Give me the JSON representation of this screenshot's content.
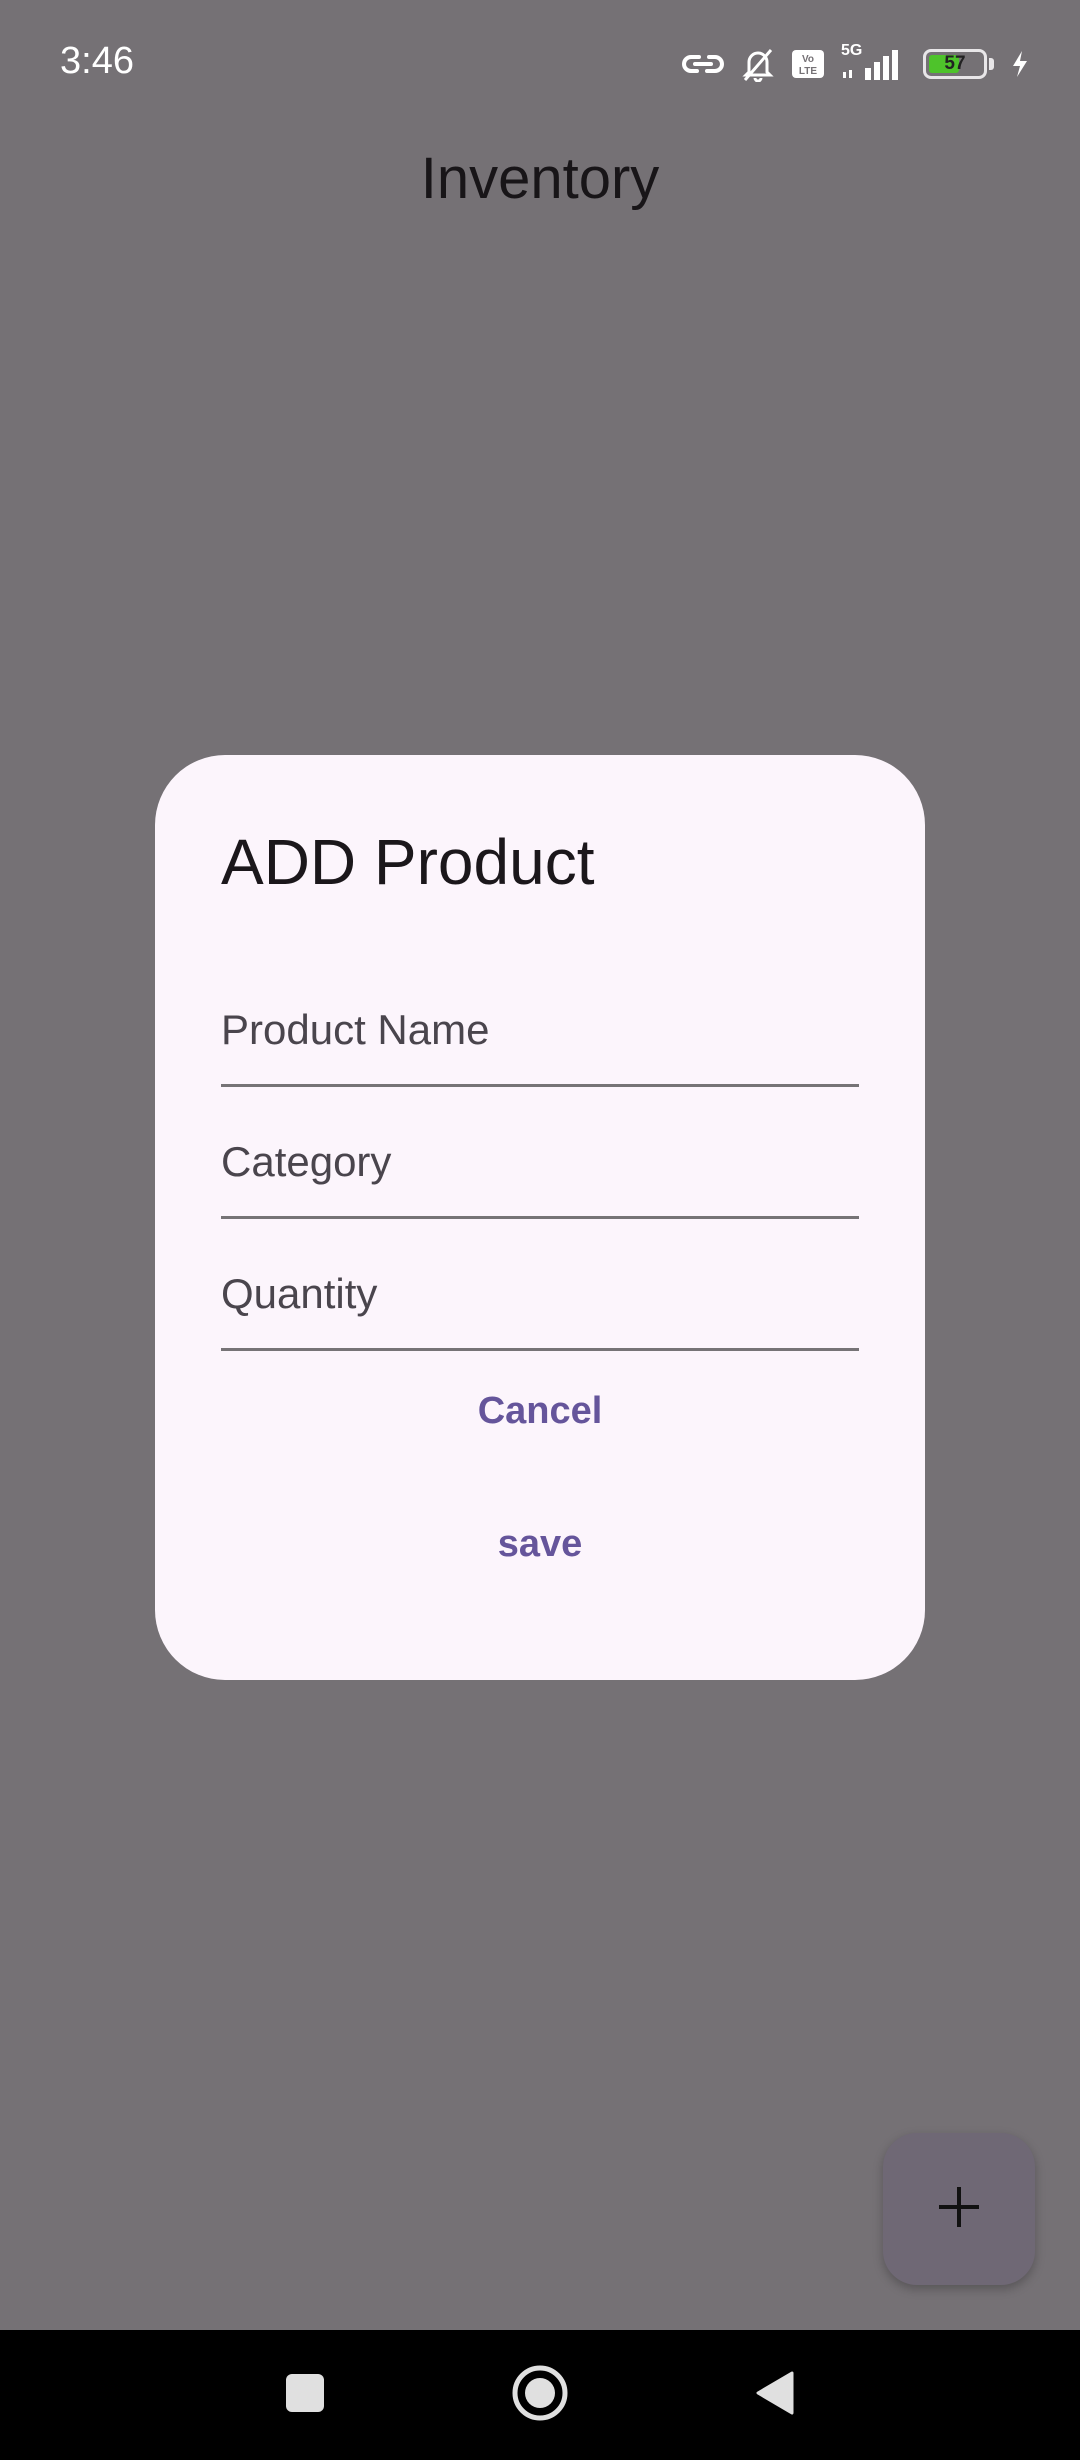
{
  "status_bar": {
    "time": "3:46",
    "network": "5G",
    "volte": "Vo LTE",
    "battery_level": 57,
    "battery_label": "57",
    "icons": [
      "link-icon",
      "bell-off-icon",
      "volte-icon",
      "signal-icon",
      "battery-icon",
      "charging-icon"
    ]
  },
  "app": {
    "title": "Inventory"
  },
  "dialog": {
    "title": "ADD Product",
    "fields": [
      {
        "placeholder": "Product Name",
        "value": ""
      },
      {
        "placeholder": "Category",
        "value": ""
      },
      {
        "placeholder": "Quantity",
        "value": ""
      }
    ],
    "cancel_label": "Cancel",
    "save_label": "save"
  },
  "fab": {
    "icon": "plus-icon"
  },
  "nav_bar": {
    "icons": [
      "recent-apps-icon",
      "home-icon",
      "back-icon"
    ]
  },
  "colors": {
    "scrim": "#757175",
    "dialog_bg": "#fcf5fc",
    "accent": "#65559b",
    "fab_bg": "#6f6875",
    "battery_green": "#4ec32b"
  }
}
